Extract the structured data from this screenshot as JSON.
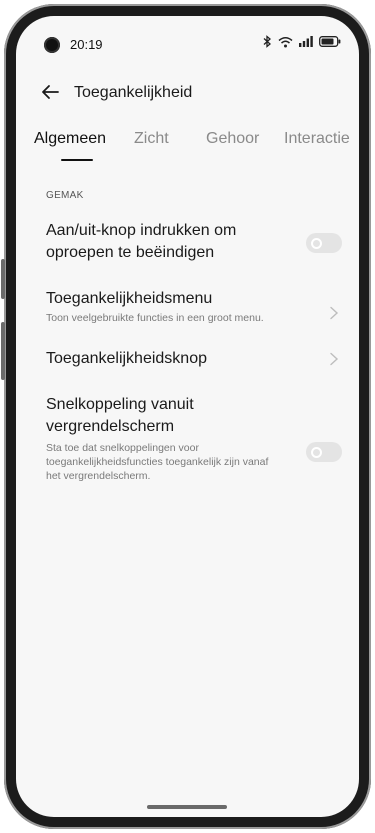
{
  "status_bar": {
    "time": "20:19",
    "icons": [
      "bluetooth-icon",
      "wifi-icon",
      "signal-icon",
      "battery-icon"
    ]
  },
  "header": {
    "title": "Toegankelijkheid",
    "back_icon": "arrow-left-icon"
  },
  "tabs": [
    {
      "label": "Algemeen",
      "active": true
    },
    {
      "label": "Zicht",
      "active": false
    },
    {
      "label": "Gehoor",
      "active": false
    },
    {
      "label": "Interactie",
      "active": false
    }
  ],
  "section": {
    "header": "GEMAK"
  },
  "settings": [
    {
      "title_lines": [
        "Aan/uit-knop indrukken om",
        "oproepen te beëindigen"
      ],
      "subtitle_lines": [],
      "control": "toggle",
      "enabled": false
    },
    {
      "title_lines": [
        "Toegankelijkheidsmenu"
      ],
      "subtitle_lines": [
        "Toon veelgebruikte functies in een groot menu."
      ],
      "control": "chevron"
    },
    {
      "title_lines": [
        "Toegankelijkheidsknop"
      ],
      "subtitle_lines": [],
      "control": "chevron"
    },
    {
      "title_lines": [
        "Snelkoppeling vanuit",
        "vergrendelscherm"
      ],
      "subtitle_lines": [
        "Sta toe dat snelkoppelingen voor",
        "toegankelijkheidsfuncties toegankelijk zijn vanaf",
        "het vergrendelscherm."
      ],
      "control": "toggle",
      "enabled": false
    }
  ],
  "colors": {
    "toggle_off": "#e4e4e4",
    "active_tab": "#111111",
    "inactive_tab": "#8a8a8a"
  }
}
